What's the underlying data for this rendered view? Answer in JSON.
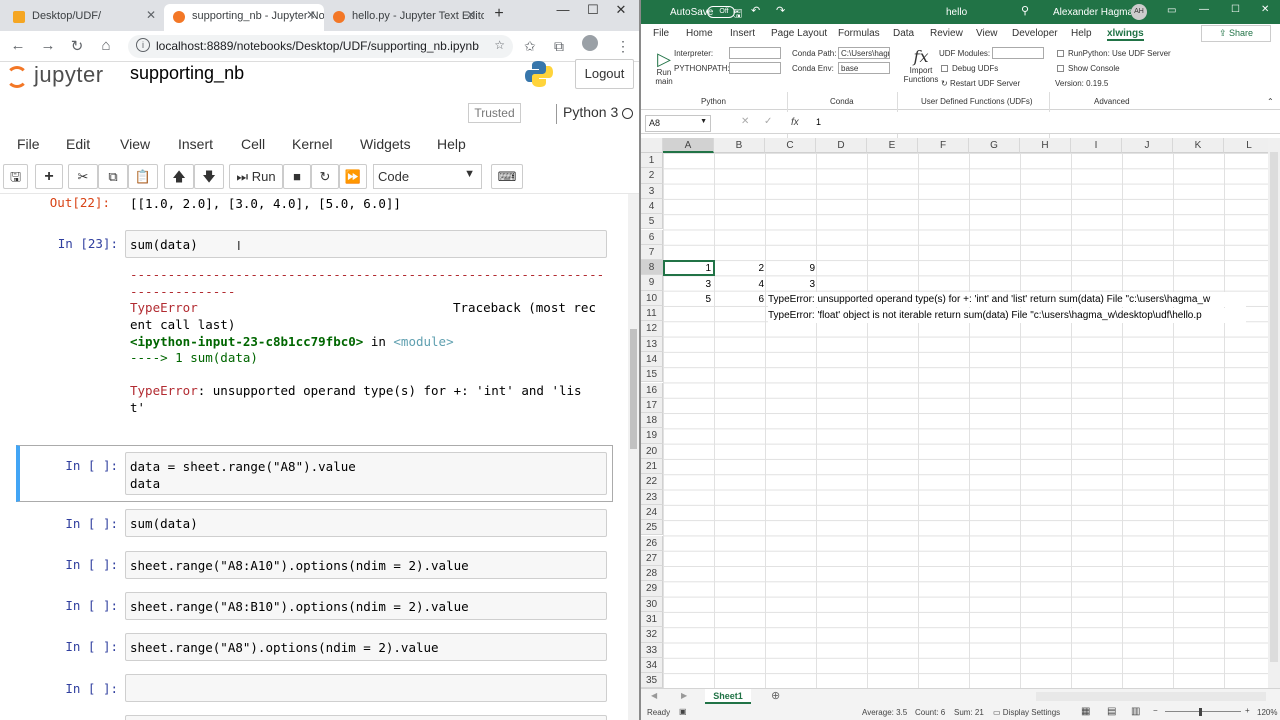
{
  "browser": {
    "tabs": [
      {
        "title": "Desktop/UDF/"
      },
      {
        "title": "supporting_nb - Jupyter Notebo"
      },
      {
        "title": "hello.py - Jupyter Text Editor"
      }
    ],
    "url": "localhost:8889/notebooks/Desktop/UDF/supporting_nb.ipynb"
  },
  "jupyter": {
    "logo": "jupyter",
    "notebook_title": "supporting_nb",
    "logout": "Logout",
    "trusted": "Trusted",
    "kernel": "Python 3",
    "menu": [
      "File",
      "Edit",
      "View",
      "Insert",
      "Cell",
      "Kernel",
      "Widgets",
      "Help"
    ],
    "run_label": "Run",
    "cell_type": "Code"
  },
  "cells": {
    "out22_prompt": "Out[22]:",
    "out22_text": "[[1.0, 2.0], [3.0, 4.0], [5.0, 6.0]]",
    "in23_prompt": "In [23]:",
    "in23_code": "sum(data)",
    "tb_dashes1": "---------------------------------------------------------------",
    "tb_dashes2": "--------------",
    "tb_err": "TypeError",
    "tb_traceback1": "Traceback (most rec",
    "tb_traceback2": "ent call last)",
    "tb_input": "<ipython-input-23-c8b1cc79fbc0>",
    "tb_in": " in ",
    "tb_module": "<module>",
    "tb_arrow": "----> 1 sum(data)",
    "tb_msg_err": "TypeError",
    "tb_msg1": ": unsupported operand type(s) for +: 'int' and 'lis",
    "tb_msg2": "t'",
    "empty_prompt": "In [ ]:",
    "code_a": "data = sheet.range(\"A8\").value\ndata",
    "code_b": "sum(data)",
    "code_c": "sheet.range(\"A8:A10\").options(ndim = 2).value",
    "code_d": "sheet.range(\"A8:B10\").options(ndim = 2).value",
    "code_e": "sheet.range(\"A8\").options(ndim = 2).value",
    "code_f": ""
  },
  "excel": {
    "autosave": "AutoSave",
    "autosave_state": "Off",
    "filename": "hello",
    "user": "Alexander Hagmann",
    "user_initials": "AH",
    "ribbon_tabs": [
      "File",
      "Home",
      "Insert",
      "Page Layout",
      "Formulas",
      "Data",
      "Review",
      "View",
      "Developer",
      "Help",
      "xlwings"
    ],
    "share": "Share",
    "ribbon": {
      "run_main": "Run main",
      "run_label": "Run",
      "main_label": "main",
      "interpreter": "Interpreter:",
      "pythonpath": "PYTHONPATH:",
      "conda_path": "Conda Path:",
      "conda_path_val": "C:\\Users\\hagr",
      "conda_env": "Conda Env:",
      "conda_env_val": "base",
      "import_functions": "Import Functions",
      "import_label": "Import",
      "functions_label": "Functions",
      "udf_modules": "UDF Modules:",
      "debug_udfs": "Debug UDFs",
      "restart_udf": "Restart UDF Server",
      "runpython": "RunPython: Use UDF Server",
      "show_console": "Show Console",
      "version": "Version: 0.19.5",
      "group_python": "Python",
      "group_conda": "Conda",
      "group_udfs": "User Defined Functions (UDFs)",
      "group_advanced": "Advanced"
    },
    "namebox": "A8",
    "formula": "1",
    "columns": [
      "A",
      "B",
      "C",
      "D",
      "E",
      "F",
      "G",
      "H",
      "I",
      "J",
      "K",
      "L"
    ],
    "cells": {
      "A8": "1",
      "B8": "2",
      "C8": "9",
      "A9": "3",
      "B9": "4",
      "C9": "3",
      "A10": "5",
      "B10": "6",
      "C10": "TypeError: unsupported operand type(s) for +: 'int' and 'list'    return sum(data)  File \"c:\\users\\hagma_w",
      "C11": "TypeError: 'float' object is not iterable    return sum(data)  File \"c:\\users\\hagma_w\\desktop\\udf\\hello.p"
    },
    "sheet": "Sheet1",
    "status": {
      "ready": "Ready",
      "average": "Average: 3.5",
      "count": "Count: 6",
      "sum": "Sum: 21",
      "display": "Display Settings",
      "zoom": "120%"
    }
  }
}
